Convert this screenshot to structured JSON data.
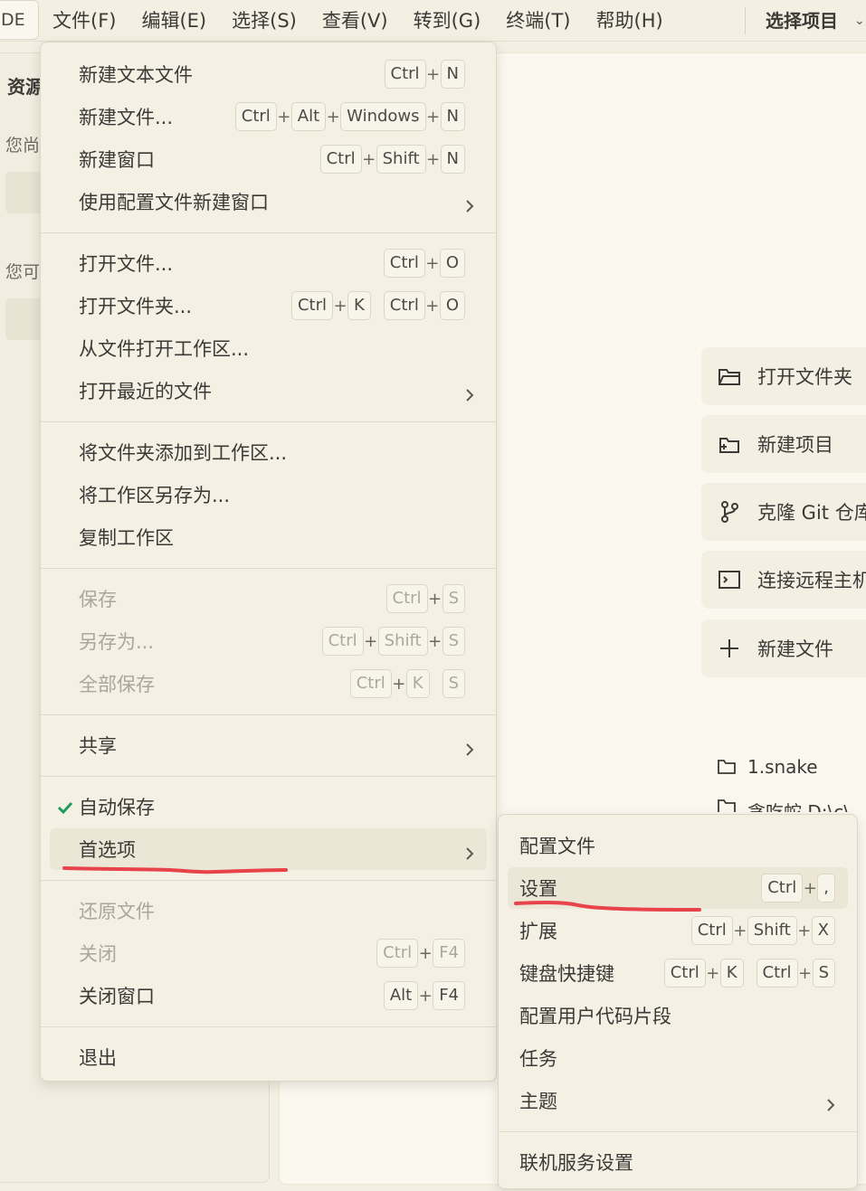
{
  "menubar": {
    "app_label": "DE",
    "items": [
      "文件(F)",
      "编辑(E)",
      "选择(S)",
      "查看(V)",
      "转到(G)",
      "终端(T)",
      "帮助(H)"
    ],
    "project_selector": "选择项目"
  },
  "sidebar": {
    "title": "资源",
    "text1": "您尚",
    "text2": "您可"
  },
  "welcome": {
    "actions": [
      "打开文件夹",
      "新建项目",
      "克隆 Git 仓库",
      "连接远程主机",
      "新建文件"
    ],
    "recent": [
      "1.snake",
      "贪吃蛇 D:\\c\\"
    ]
  },
  "file_menu": {
    "groups": [
      [
        {
          "label": "新建文本文件",
          "keys": [
            [
              "Ctrl",
              "N"
            ]
          ]
        },
        {
          "label": "新建文件...",
          "keys": [
            [
              "Ctrl",
              "Alt",
              "Windows",
              "N"
            ]
          ]
        },
        {
          "label": "新建窗口",
          "keys": [
            [
              "Ctrl",
              "Shift",
              "N"
            ]
          ]
        },
        {
          "label": "使用配置文件新建窗口",
          "submenu": true
        }
      ],
      [
        {
          "label": "打开文件...",
          "keys": [
            [
              "Ctrl",
              "O"
            ]
          ]
        },
        {
          "label": "打开文件夹...",
          "keys": [
            [
              "Ctrl",
              "K"
            ],
            [
              "Ctrl",
              "O"
            ]
          ]
        },
        {
          "label": "从文件打开工作区..."
        },
        {
          "label": "打开最近的文件",
          "submenu": true
        }
      ],
      [
        {
          "label": "将文件夹添加到工作区..."
        },
        {
          "label": "将工作区另存为..."
        },
        {
          "label": "复制工作区"
        }
      ],
      [
        {
          "label": "保存",
          "keys": [
            [
              "Ctrl",
              "S"
            ]
          ],
          "disabled": true
        },
        {
          "label": "另存为...",
          "keys": [
            [
              "Ctrl",
              "Shift",
              "S"
            ]
          ],
          "disabled": true
        },
        {
          "label": "全部保存",
          "keys": [
            [
              "Ctrl",
              "K"
            ],
            [
              "S"
            ]
          ],
          "disabled": true
        }
      ],
      [
        {
          "label": "共享",
          "submenu": true
        }
      ],
      [
        {
          "label": "自动保存",
          "checked": true
        },
        {
          "label": "首选项",
          "submenu": true,
          "highlight": true
        }
      ],
      [
        {
          "label": "还原文件",
          "disabled": true
        },
        {
          "label": "关闭",
          "keys": [
            [
              "Ctrl",
              "F4"
            ]
          ],
          "disabled": true
        },
        {
          "label": "关闭窗口",
          "keys": [
            [
              "Alt",
              "F4"
            ]
          ]
        }
      ],
      [
        {
          "label": "退出"
        }
      ]
    ]
  },
  "preferences_menu": {
    "groups": [
      [
        {
          "label": "配置文件"
        },
        {
          "label": "设置",
          "keys": [
            [
              "Ctrl",
              ","
            ]
          ],
          "highlight": true
        },
        {
          "label": "扩展",
          "keys": [
            [
              "Ctrl",
              "Shift",
              "X"
            ]
          ]
        },
        {
          "label": "键盘快捷键",
          "keys": [
            [
              "Ctrl",
              "K"
            ],
            [
              "Ctrl",
              "S"
            ]
          ]
        },
        {
          "label": "配置用户代码片段"
        },
        {
          "label": "任务"
        },
        {
          "label": "主题",
          "submenu": true
        }
      ],
      [
        {
          "label": "联机服务设置"
        }
      ]
    ]
  },
  "colors": {
    "background": "#f3efe2",
    "menu_bg": "#f4f0e4",
    "highlight": "#ebe6d5",
    "check": "#1d9b5a",
    "annotation_red": "#e8424a"
  }
}
